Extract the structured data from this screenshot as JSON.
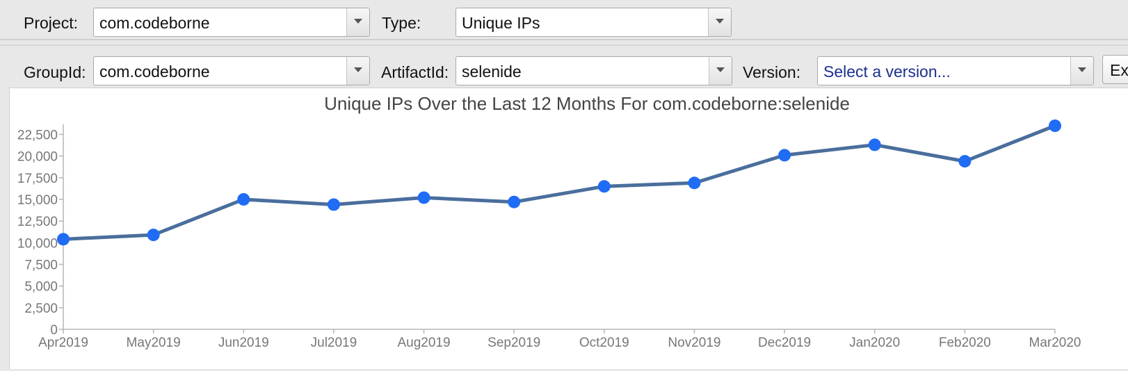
{
  "filters": {
    "project": {
      "label": "Project:",
      "value": "com.codeborne"
    },
    "type": {
      "label": "Type:",
      "value": "Unique IPs"
    },
    "group_id": {
      "label": "GroupId:",
      "value": "com.codeborne"
    },
    "artifact_id": {
      "label": "ArtifactId:",
      "value": "selenide"
    },
    "version": {
      "label": "Version:",
      "placeholder": "Select a version..."
    },
    "export_button_label": "Ex"
  },
  "colors": {
    "line": "#4a6e9c",
    "marker": "#1f6cf5",
    "axis": "#b5b5b5"
  },
  "chart_data": {
    "type": "line",
    "title": "Unique IPs Over the Last 12 Months For com.codeborne:selenide",
    "xlabel": "",
    "ylabel": "",
    "categories": [
      "Apr2019",
      "May2019",
      "Jun2019",
      "Jul2019",
      "Aug2019",
      "Sep2019",
      "Oct2019",
      "Nov2019",
      "Dec2019",
      "Jan2020",
      "Feb2020",
      "Mar2020"
    ],
    "values": [
      10400,
      10900,
      15000,
      14400,
      15200,
      14700,
      16500,
      16900,
      20100,
      21300,
      19400,
      23500
    ],
    "ylim": [
      0,
      23500
    ],
    "yticks": [
      0,
      2500,
      5000,
      7500,
      10000,
      12500,
      15000,
      17500,
      20000,
      22500
    ],
    "ytick_labels": [
      "0",
      "2,500",
      "5,000",
      "7,500",
      "10,000",
      "12,500",
      "15,000",
      "17,500",
      "20,000",
      "22,500"
    ],
    "grid": false,
    "legend": "none"
  }
}
